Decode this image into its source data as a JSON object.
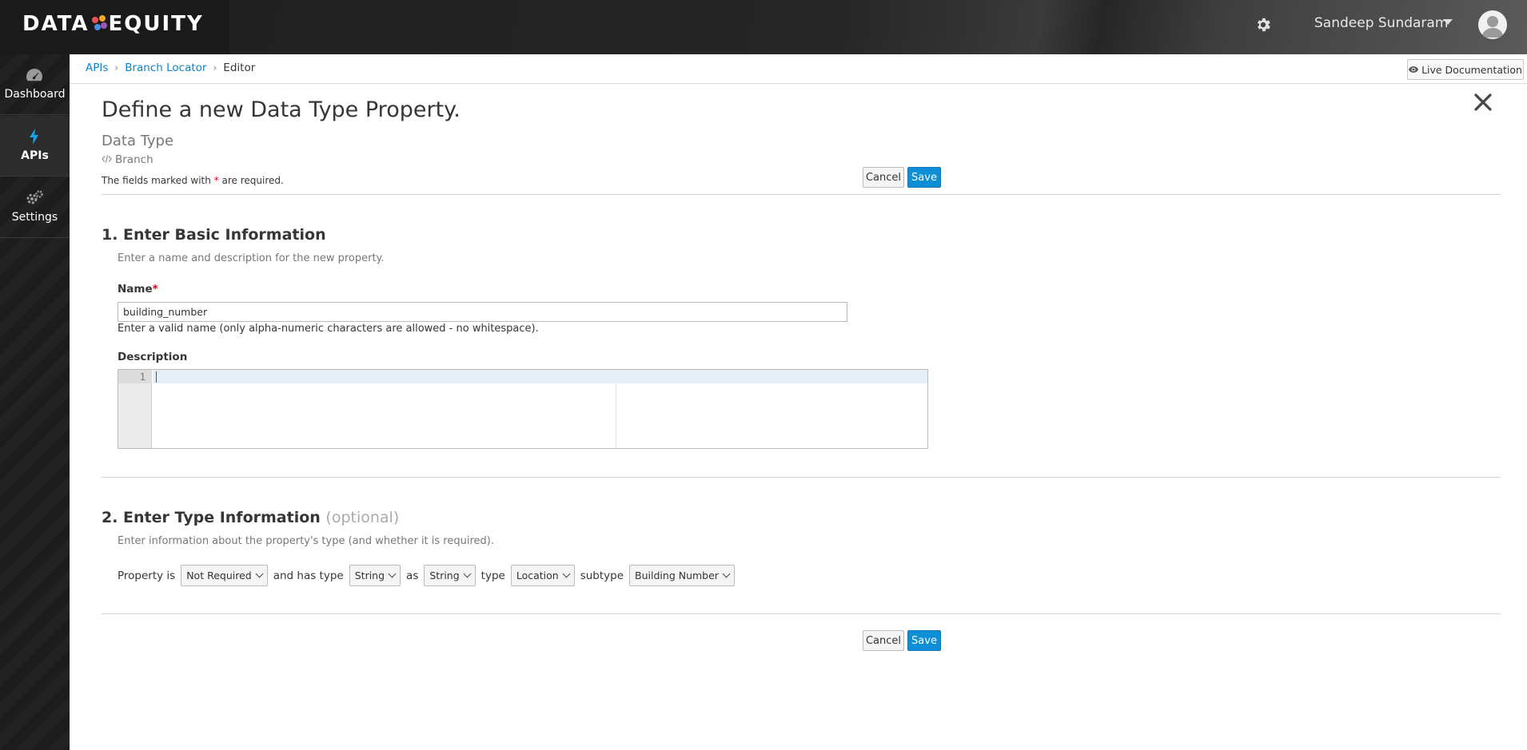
{
  "header": {
    "logo_left": "DATA",
    "logo_right": "EQUITY",
    "user_name": "Sandeep Sundaram",
    "icons": [
      "gear-icon",
      "chevron-down-icon",
      "user-avatar-icon"
    ]
  },
  "sidebar": {
    "items": [
      {
        "label": "Dashboard",
        "icon": "dashboard-icon"
      },
      {
        "label": "APIs",
        "icon": "bolt-icon",
        "active": true
      },
      {
        "label": "Settings",
        "icon": "gears-icon"
      }
    ]
  },
  "breadcrumb": {
    "items": [
      "APIs",
      "Branch Locator",
      "Editor"
    ]
  },
  "live_doc": {
    "label": "Live Documentation",
    "icon": "eye-icon"
  },
  "page": {
    "title": "Define a new Data Type Property.",
    "data_type_label": "Data Type",
    "data_type_value": "Branch",
    "required_prefix": "The fields marked with",
    "required_star": "*",
    "required_suffix": "are required."
  },
  "buttons": {
    "cancel": "Cancel",
    "save": "Save"
  },
  "section1": {
    "title": "1. Enter Basic Information",
    "desc": "Enter a name and description for the new property.",
    "name_label": "Name",
    "name_star": "*",
    "name_value": "building_number",
    "name_help": "Enter a valid name (only alpha-numeric characters are allowed - no whitespace).",
    "desc_label": "Description",
    "editor_line": "1"
  },
  "section2": {
    "title": "2. Enter Type Information",
    "title_optional": "(optional)",
    "desc": "Enter information about the property's type (and whether it is required).",
    "t1": "Property is",
    "sel_required": "Not Required",
    "t2": "and has type",
    "sel_type": "String",
    "t3": "as",
    "sel_as": "String",
    "t4": "type",
    "sel_type2": "Location",
    "t5": "subtype",
    "sel_subtype": "Building Number"
  },
  "colors": {
    "accent": "#0c8fd6",
    "link": "#0c86c8",
    "required": "#d0021b"
  }
}
